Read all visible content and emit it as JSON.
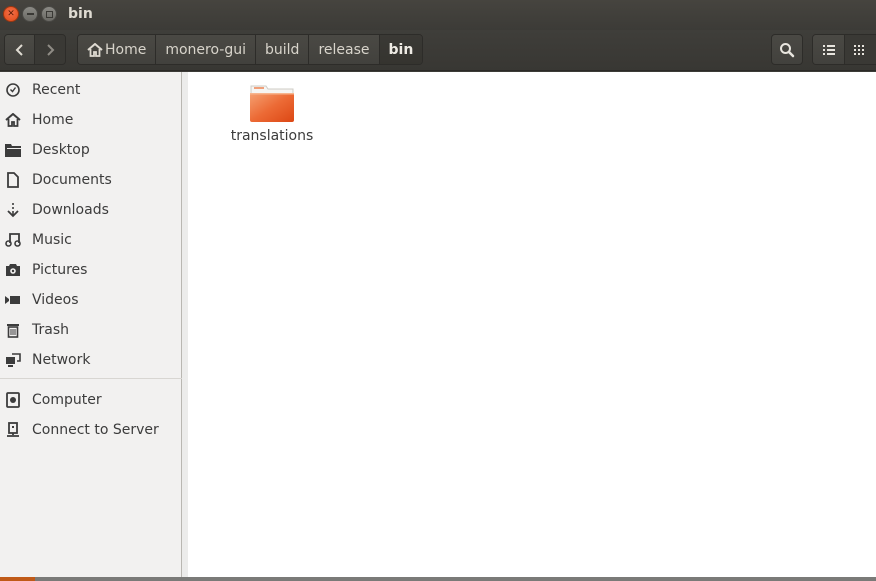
{
  "window": {
    "title": "bin",
    "controls": {
      "close": "close-icon",
      "minimize": "minimize-icon",
      "maximize": "maximize-icon"
    }
  },
  "toolbar": {
    "back_icon": "chevron-left-icon",
    "forward_icon": "chevron-right-icon",
    "breadcrumbs": [
      {
        "label": "Home",
        "icon": "home-icon"
      },
      {
        "label": "monero-gui"
      },
      {
        "label": "build"
      },
      {
        "label": "release"
      },
      {
        "label": "bin",
        "active": true
      }
    ],
    "search_icon": "search-icon",
    "list_view_icon": "list-view-icon",
    "grid_view_icon": "grid-view-icon"
  },
  "sidebar": {
    "items": [
      {
        "label": "Recent",
        "icon": "clock-icon"
      },
      {
        "label": "Home",
        "icon": "home-icon"
      },
      {
        "label": "Desktop",
        "icon": "folder-icon"
      },
      {
        "label": "Documents",
        "icon": "document-icon"
      },
      {
        "label": "Downloads",
        "icon": "download-icon"
      },
      {
        "label": "Music",
        "icon": "music-icon"
      },
      {
        "label": "Pictures",
        "icon": "camera-icon"
      },
      {
        "label": "Videos",
        "icon": "video-icon"
      },
      {
        "label": "Trash",
        "icon": "trash-icon"
      },
      {
        "label": "Network",
        "icon": "network-icon"
      }
    ],
    "devices": [
      {
        "label": "Computer",
        "icon": "computer-icon"
      },
      {
        "label": "Connect to Server",
        "icon": "server-icon"
      }
    ]
  },
  "content": {
    "files": [
      {
        "name": "translations",
        "type": "folder",
        "icon": "folder-icon"
      }
    ]
  },
  "colors": {
    "accent_orange": "#e95420",
    "titlebar": "#3c3b37",
    "sidebar_bg": "#f2f1f0"
  }
}
